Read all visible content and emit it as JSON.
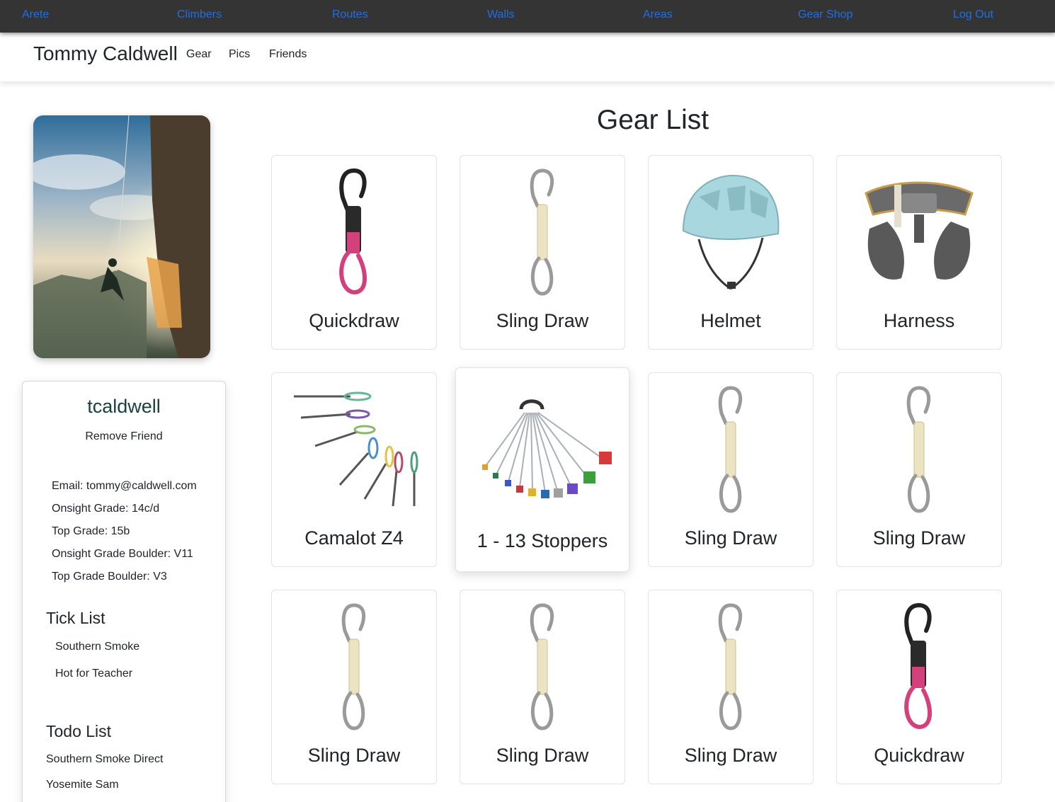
{
  "nav": {
    "items": [
      "Arete",
      "Climbers",
      "Routes",
      "Walls",
      "Areas",
      "Gear Shop",
      "Log Out"
    ],
    "link_color": "#1f6fe5",
    "bar_color": "#343434"
  },
  "subheader": {
    "name": "Tommy Caldwell",
    "links": [
      "Gear",
      "Pics",
      "Friends"
    ]
  },
  "profile": {
    "username": "tcaldwell",
    "action": "Remove Friend",
    "stats": [
      "Email: tommy@caldwell.com",
      "Onsight Grade: 14c/d",
      "Top Grade: 15b",
      "Onsight Grade Boulder: V11",
      "Top Grade Boulder: V3"
    ],
    "tick_list_title": "Tick List",
    "tick_list": [
      "Southern Smoke",
      "Hot for Teacher"
    ],
    "todo_list_title": "Todo List",
    "todo_list": [
      "Southern Smoke Direct",
      "Yosemite Sam"
    ]
  },
  "gear": {
    "title": "Gear List",
    "items": [
      {
        "name": "Quickdraw",
        "icon": "quickdraw-icon"
      },
      {
        "name": "Sling Draw",
        "icon": "sling-draw-icon"
      },
      {
        "name": "Helmet",
        "icon": "helmet-icon"
      },
      {
        "name": "Harness",
        "icon": "harness-icon"
      },
      {
        "name": "Camalot Z4",
        "icon": "camalot-icon"
      },
      {
        "name": "1 - 13 Stoppers",
        "icon": "stoppers-icon"
      },
      {
        "name": "Sling Draw",
        "icon": "sling-draw-icon"
      },
      {
        "name": "Sling Draw",
        "icon": "sling-draw-icon"
      },
      {
        "name": "Sling Draw",
        "icon": "sling-draw-icon"
      },
      {
        "name": "Sling Draw",
        "icon": "sling-draw-icon"
      },
      {
        "name": "Sling Draw",
        "icon": "sling-draw-icon"
      },
      {
        "name": "Quickdraw",
        "icon": "quickdraw-icon"
      }
    ]
  }
}
